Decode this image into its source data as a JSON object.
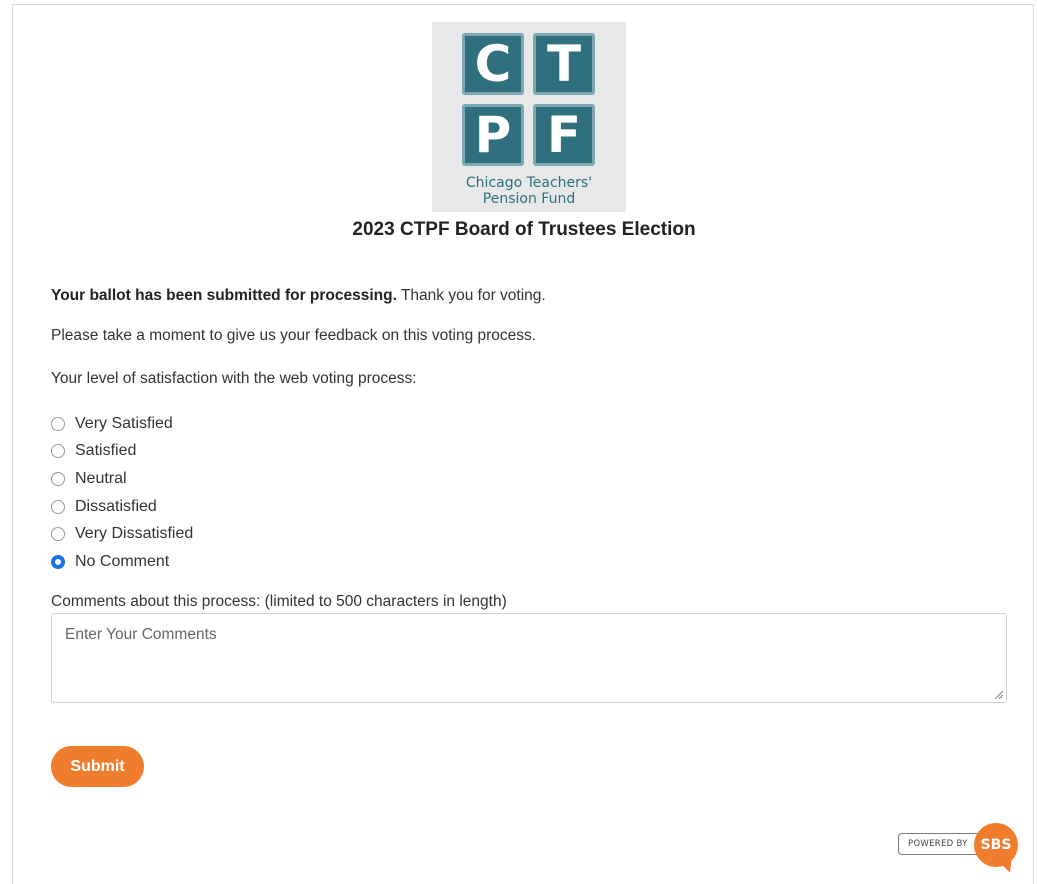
{
  "logo": {
    "letters": [
      "C",
      "T",
      "P",
      "F"
    ],
    "line1": "Chicago Teachers'",
    "line2": "Pension Fund"
  },
  "title": "2023 CTPF Board of Trustees Election",
  "confirmation": {
    "bold": "Your ballot has been submitted for processing.",
    "rest": " Thank you for voting."
  },
  "feedback_prompt": "Please take a moment to give us your feedback on this voting process.",
  "satisfaction_label": "Your level of satisfaction with the web voting process:",
  "options": [
    {
      "label": "Very Satisfied",
      "checked": false
    },
    {
      "label": "Satisfied",
      "checked": false
    },
    {
      "label": "Neutral",
      "checked": false
    },
    {
      "label": "Dissatisfied",
      "checked": false
    },
    {
      "label": "Very Dissatisfied",
      "checked": false
    },
    {
      "label": "No Comment",
      "checked": true
    }
  ],
  "comments": {
    "label": "Comments about this process: (limited to 500 characters in length)",
    "placeholder": "Enter Your Comments",
    "value": ""
  },
  "submit_label": "Submit",
  "powered_by": {
    "text": "POWERED BY",
    "brand": "SBS"
  },
  "colors": {
    "accent": "#f07c2e",
    "logo_teal": "#2f6f7e",
    "radio_selected": "#1a73e8"
  }
}
